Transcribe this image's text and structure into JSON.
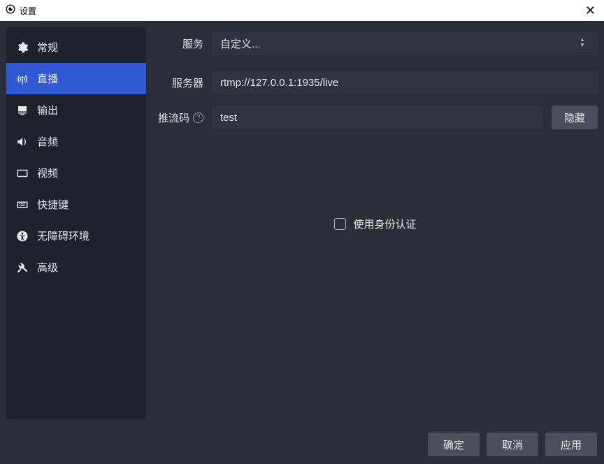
{
  "window": {
    "title": "设置",
    "close": "✕"
  },
  "sidebar": {
    "items": [
      {
        "label": "常规",
        "icon": "gear-icon"
      },
      {
        "label": "直播",
        "icon": "antenna-icon"
      },
      {
        "label": "输出",
        "icon": "output-icon"
      },
      {
        "label": "音频",
        "icon": "audio-icon"
      },
      {
        "label": "视频",
        "icon": "video-icon"
      },
      {
        "label": "快捷键",
        "icon": "keyboard-icon"
      },
      {
        "label": "无障碍环境",
        "icon": "accessibility-icon"
      },
      {
        "label": "高级",
        "icon": "tools-icon"
      }
    ],
    "active_index": 1
  },
  "form": {
    "service": {
      "label": "服务",
      "value": "自定义..."
    },
    "server": {
      "label": "服务器",
      "value": "rtmp://127.0.0.1:1935/live"
    },
    "stream_key": {
      "label": "推流码",
      "value": "test",
      "hide_btn": "隐藏"
    },
    "auth_checkbox": {
      "label": "使用身份认证",
      "checked": false
    }
  },
  "footer": {
    "ok": "确定",
    "cancel": "取消",
    "apply": "应用"
  }
}
